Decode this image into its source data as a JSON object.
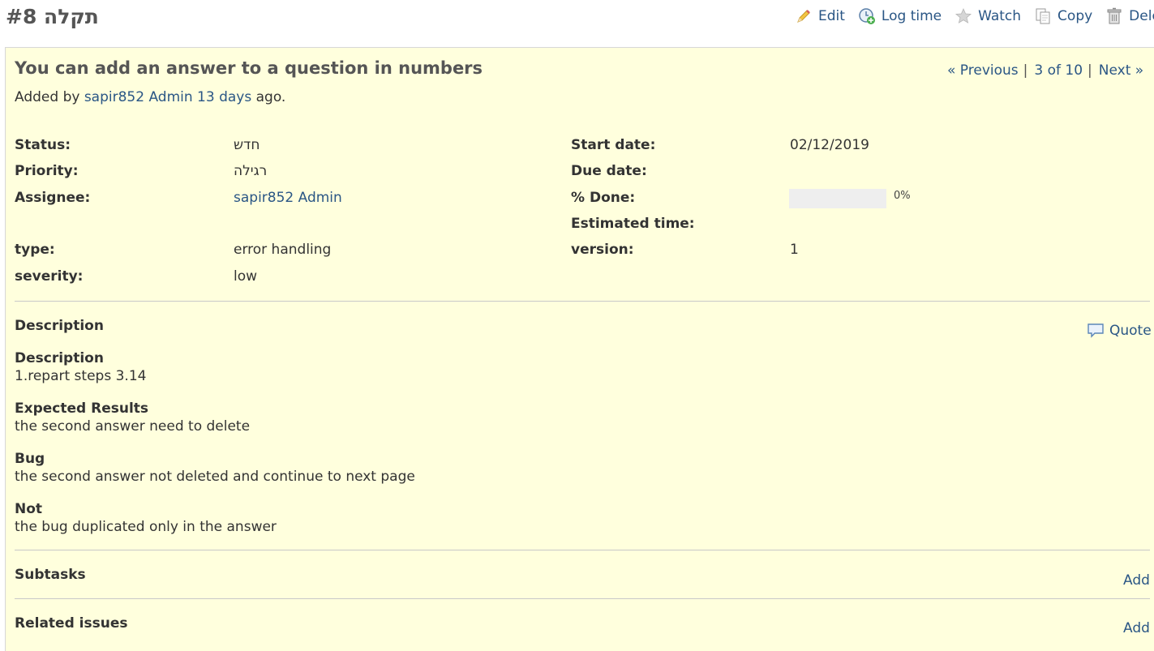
{
  "page": {
    "title": "תקלה #8"
  },
  "actions": [
    {
      "label": "Edit",
      "icon": "pencil-icon"
    },
    {
      "label": "Log time",
      "icon": "clock-add-icon"
    },
    {
      "label": "Watch",
      "icon": "star-icon"
    },
    {
      "label": "Copy",
      "icon": "copy-icon"
    },
    {
      "label": "Delete",
      "icon": "trash-icon"
    }
  ],
  "issue": {
    "subject": "You can add an answer to a question in numbers",
    "author_prefix": "Added by",
    "author": "sapir852 Admin",
    "age": "13 days",
    "author_suffix": "ago.",
    "nav": {
      "previous": "« Previous",
      "position": "3 of 10",
      "next": "Next »"
    },
    "attributes": {
      "status": {
        "label": "Status:",
        "value": "חדש"
      },
      "priority": {
        "label": "Priority:",
        "value": "רגילה"
      },
      "assignee": {
        "label": "Assignee:",
        "value": "sapir852 Admin"
      },
      "type": {
        "label": "type:",
        "value": "error handling"
      },
      "severity": {
        "label": "severity:",
        "value": "low"
      },
      "start_date": {
        "label": "Start date:",
        "value": "02/12/2019"
      },
      "due_date": {
        "label": "Due date:",
        "value": ""
      },
      "done": {
        "label": "% Done:",
        "value": "0%",
        "fraction": 0.0
      },
      "estimated_time": {
        "label": "Estimated time:",
        "value": ""
      },
      "version": {
        "label": "version:",
        "value": "1"
      }
    },
    "description": {
      "title": "Description",
      "quote_label": "Quote",
      "sections": [
        {
          "heading": "Description",
          "text": "1.repart steps 3.14"
        },
        {
          "heading": "Expected Results",
          "text": "the second answer need to delete"
        },
        {
          "heading": "Bug",
          "text": "the second answer not deleted and continue to next page"
        },
        {
          "heading": "Not",
          "text": "the bug duplicated only in the answer"
        }
      ]
    },
    "subtasks": {
      "title": "Subtasks",
      "add_label": "Add"
    },
    "related": {
      "title": "Related issues",
      "add_label": "Add"
    }
  },
  "colors": {
    "issue_background": "#ffffdd",
    "link": "#2a5685",
    "progress_track": "#eeeeee"
  }
}
